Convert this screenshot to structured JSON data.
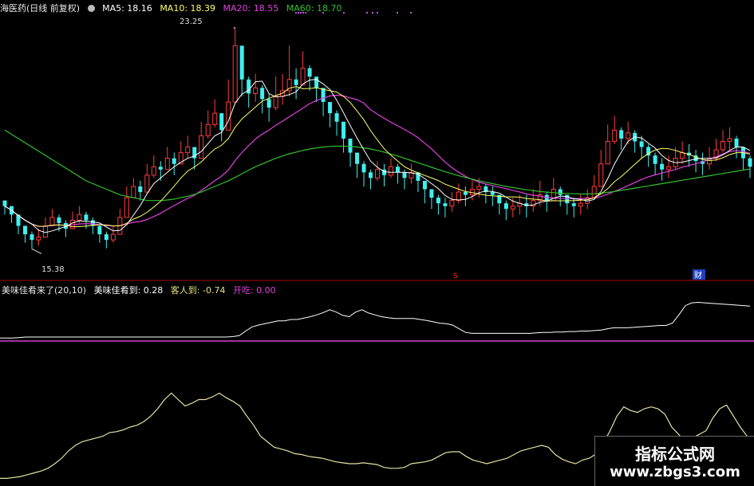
{
  "header": {
    "stock_title": "海医药(日线 前复权)",
    "gear_icon": "gear-icon",
    "ma5_label": "MA5: 18.16",
    "ma10_label": "MA10: 18.39",
    "ma20_label": "MA20: 18.55",
    "ma60_label": "MA60: 18.70"
  },
  "indicator_header": {
    "name": "美味佳肴来了(20,10)",
    "v1": "美味佳肴到: 0.28",
    "v2": "客人到: -0.74",
    "v3": "开吃: 0.00"
  },
  "annotations": {
    "high": "23.25",
    "low": "15.38",
    "marker_s": "S",
    "marker_cai": "财"
  },
  "watermark": {
    "line1": "指标公式网",
    "line2": "www.zbgs3.com"
  },
  "colors": {
    "up": "#ff3c3c",
    "down": "#3ff0f0",
    "ma5": "#ffffff",
    "ma10": "#ffff66",
    "ma20": "#e040e0",
    "ma60": "#30c030",
    "ind_line": "#ffffff",
    "ind_base": "#d040d0",
    "lower_line": "#e6e0a0",
    "separator": "#b00000"
  },
  "chart_data": [
    {
      "type": "candlestick",
      "series": [
        {
          "name": "MA5",
          "color": "#ffffff"
        },
        {
          "name": "MA10",
          "color": "#ffff66"
        },
        {
          "name": "MA20",
          "color": "#e040e0"
        },
        {
          "name": "MA60",
          "color": "#30c030"
        }
      ],
      "ylim": [
        14.6,
        23.6
      ],
      "close": [
        16.9,
        16.6,
        16.2,
        15.9,
        15.7,
        15.8,
        16.2,
        16.5,
        16.3,
        16.1,
        16.4,
        16.6,
        16.4,
        16.2,
        15.9,
        15.7,
        15.9,
        16.5,
        17.2,
        17.6,
        17.4,
        18.0,
        18.3,
        18.2,
        18.6,
        18.4,
        18.8,
        19.0,
        18.6,
        19.4,
        19.8,
        20.2,
        19.6,
        20.6,
        22.6,
        21.4,
        20.9,
        21.1,
        20.7,
        20.4,
        20.8,
        21.0,
        21.4,
        21.2,
        21.8,
        21.5,
        21.1,
        20.6,
        20.2,
        19.9,
        19.3,
        18.8,
        18.4,
        18.1,
        17.9,
        18.2,
        18.0,
        18.3,
        18.1,
        17.9,
        18.1,
        17.8,
        17.5,
        17.2,
        17.0,
        16.9,
        17.1,
        17.4,
        17.3,
        17.5,
        17.6,
        17.4,
        17.3,
        17.0,
        16.8,
        16.9,
        17.0,
        16.9,
        17.1,
        17.3,
        17.1,
        17.5,
        17.3,
        17.0,
        16.9,
        17.0,
        17.2,
        17.6,
        18.4,
        19.2,
        19.6,
        19.3,
        19.5,
        19.2,
        19.0,
        18.7,
        18.4,
        18.2,
        18.3,
        18.6,
        18.8,
        18.7,
        18.5,
        18.4,
        18.6,
        18.9,
        19.2,
        19.3,
        19.0,
        18.6,
        18.3
      ],
      "high": [
        17.1,
        16.9,
        16.5,
        16.2,
        16.0,
        16.1,
        16.5,
        16.8,
        16.6,
        16.4,
        16.7,
        16.9,
        16.7,
        16.5,
        16.2,
        16.0,
        16.2,
        16.8,
        17.6,
        17.9,
        17.8,
        18.4,
        18.7,
        18.5,
        19.0,
        18.8,
        19.2,
        19.4,
        19.0,
        19.9,
        20.3,
        20.7,
        20.2,
        21.4,
        23.25,
        22.2,
        21.5,
        21.6,
        21.2,
        20.9,
        21.5,
        21.6,
        22.6,
        21.8,
        22.4,
        21.9,
        21.5,
        21.0,
        20.6,
        20.3,
        19.8,
        19.2,
        18.8,
        18.5,
        18.2,
        18.5,
        18.4,
        18.6,
        18.4,
        18.2,
        18.4,
        18.1,
        17.8,
        17.5,
        17.3,
        17.2,
        17.4,
        17.7,
        17.6,
        17.8,
        17.9,
        17.7,
        17.6,
        17.3,
        17.1,
        17.2,
        17.3,
        17.3,
        17.5,
        17.8,
        17.4,
        17.9,
        17.6,
        17.3,
        17.2,
        17.3,
        17.5,
        18.0,
        18.9,
        19.8,
        20.1,
        19.7,
        19.9,
        19.6,
        19.4,
        19.1,
        18.8,
        18.6,
        18.7,
        19.0,
        19.2,
        19.1,
        18.9,
        18.8,
        19.0,
        19.3,
        19.6,
        19.7,
        19.4,
        19.0,
        18.7
      ],
      "low": [
        16.6,
        16.3,
        15.9,
        15.6,
        15.38,
        15.5,
        15.9,
        16.2,
        16.0,
        15.8,
        16.1,
        16.3,
        16.1,
        15.9,
        15.6,
        15.4,
        15.6,
        16.2,
        16.9,
        17.3,
        17.1,
        17.6,
        17.9,
        17.8,
        18.2,
        18.0,
        18.4,
        18.6,
        18.2,
        19.0,
        19.3,
        19.7,
        19.2,
        20.1,
        21.4,
        20.8,
        20.4,
        20.6,
        20.2,
        19.9,
        20.3,
        20.5,
        20.8,
        20.7,
        21.3,
        21.0,
        20.6,
        20.1,
        19.7,
        19.4,
        18.8,
        18.3,
        17.9,
        17.6,
        17.5,
        17.8,
        17.6,
        17.9,
        17.7,
        17.5,
        17.7,
        17.4,
        17.0,
        16.8,
        16.6,
        16.5,
        16.7,
        17.0,
        16.9,
        17.1,
        17.2,
        17.0,
        16.9,
        16.6,
        16.4,
        16.5,
        16.6,
        16.5,
        16.7,
        16.9,
        16.7,
        17.1,
        16.9,
        16.6,
        16.5,
        16.6,
        16.8,
        17.2,
        17.9,
        18.7,
        19.1,
        18.9,
        19.1,
        18.8,
        18.6,
        18.3,
        18.0,
        17.8,
        17.9,
        18.2,
        18.4,
        18.3,
        18.1,
        18.0,
        18.2,
        18.5,
        18.8,
        18.9,
        18.6,
        18.2,
        17.9
      ],
      "ma60": [
        19.6,
        19.45,
        19.3,
        19.15,
        19.0,
        18.85,
        18.7,
        18.55,
        18.4,
        18.25,
        18.1,
        17.95,
        17.8,
        17.7,
        17.6,
        17.5,
        17.4,
        17.3,
        17.25,
        17.2,
        17.15,
        17.1,
        17.1,
        17.1,
        17.12,
        17.15,
        17.2,
        17.25,
        17.32,
        17.4,
        17.5,
        17.6,
        17.7,
        17.8,
        17.92,
        18.05,
        18.18,
        18.3,
        18.4,
        18.5,
        18.6,
        18.68,
        18.76,
        18.82,
        18.88,
        18.93,
        18.97,
        19.0,
        19.02,
        19.03,
        19.03,
        19.02,
        19.0,
        18.97,
        18.93,
        18.88,
        18.82,
        18.75,
        18.68,
        18.6,
        18.52,
        18.44,
        18.36,
        18.28,
        18.2,
        18.12,
        18.05,
        17.98,
        17.92,
        17.86,
        17.8,
        17.75,
        17.7,
        17.65,
        17.6,
        17.56,
        17.52,
        17.48,
        17.45,
        17.42,
        17.4,
        17.38,
        17.36,
        17.35,
        17.34,
        17.33,
        17.33,
        17.34,
        17.36,
        17.39,
        17.42,
        17.46,
        17.5,
        17.54,
        17.58,
        17.62,
        17.66,
        17.7,
        17.74,
        17.78,
        17.82,
        17.86,
        17.9,
        17.94,
        17.98,
        18.02,
        18.06,
        18.1,
        18.14,
        18.18,
        18.22
      ]
    },
    {
      "type": "line",
      "name": "美味佳肴来了",
      "values": [
        0.1,
        0.1,
        0.1,
        0.11,
        0.12,
        0.12,
        0.12,
        0.12,
        0.12,
        0.12,
        0.12,
        0.12,
        0.12,
        0.12,
        0.12,
        0.12,
        0.12,
        0.12,
        0.12,
        0.12,
        0.12,
        0.12,
        0.12,
        0.12,
        0.12,
        0.12,
        0.12,
        0.12,
        0.12,
        0.12,
        0.12,
        0.12,
        0.12,
        0.12,
        0.12,
        0.12,
        0.13,
        0.15,
        0.25,
        0.34,
        0.38,
        0.41,
        0.44,
        0.47,
        0.47,
        0.5,
        0.5,
        0.53,
        0.56,
        0.6,
        0.65,
        0.71,
        0.66,
        0.59,
        0.56,
        0.66,
        0.71,
        0.64,
        0.6,
        0.56,
        0.54,
        0.52,
        0.52,
        0.52,
        0.52,
        0.5,
        0.48,
        0.45,
        0.42,
        0.41,
        0.38,
        0.3,
        0.22,
        0.2,
        0.2,
        0.2,
        0.2,
        0.2,
        0.2,
        0.2,
        0.2,
        0.2,
        0.2,
        0.21,
        0.22,
        0.22,
        0.23,
        0.23,
        0.24,
        0.24,
        0.25,
        0.25,
        0.26,
        0.27,
        0.3,
        0.32,
        0.32,
        0.32,
        0.33,
        0.34,
        0.35,
        0.36,
        0.37,
        0.37,
        0.42,
        0.6,
        0.8,
        0.86,
        0.87,
        0.86,
        0.85,
        0.84,
        0.83,
        0.82,
        0.81,
        0.8,
        0.79
      ]
    },
    {
      "type": "line",
      "name": "lower",
      "values": [
        0.04,
        0.04,
        0.05,
        0.06,
        0.08,
        0.1,
        0.12,
        0.15,
        0.2,
        0.26,
        0.34,
        0.4,
        0.44,
        0.46,
        0.48,
        0.5,
        0.54,
        0.55,
        0.57,
        0.6,
        0.62,
        0.66,
        0.72,
        0.8,
        0.9,
        0.97,
        0.9,
        0.83,
        0.86,
        0.9,
        0.9,
        0.93,
        0.97,
        0.92,
        0.88,
        0.83,
        0.72,
        0.62,
        0.5,
        0.44,
        0.38,
        0.36,
        0.34,
        0.31,
        0.3,
        0.28,
        0.27,
        0.26,
        0.24,
        0.22,
        0.21,
        0.2,
        0.2,
        0.21,
        0.2,
        0.19,
        0.16,
        0.15,
        0.15,
        0.16,
        0.2,
        0.21,
        0.22,
        0.24,
        0.28,
        0.32,
        0.33,
        0.33,
        0.28,
        0.24,
        0.22,
        0.2,
        0.22,
        0.24,
        0.26,
        0.3,
        0.34,
        0.36,
        0.38,
        0.4,
        0.38,
        0.3,
        0.25,
        0.22,
        0.2,
        0.24,
        0.26,
        0.31,
        0.42,
        0.56,
        0.72,
        0.82,
        0.78,
        0.76,
        0.8,
        0.82,
        0.8,
        0.74,
        0.6,
        0.52,
        0.44,
        0.48,
        0.52,
        0.56,
        0.7,
        0.8,
        0.84,
        0.72,
        0.6,
        0.5,
        0.42
      ]
    }
  ]
}
